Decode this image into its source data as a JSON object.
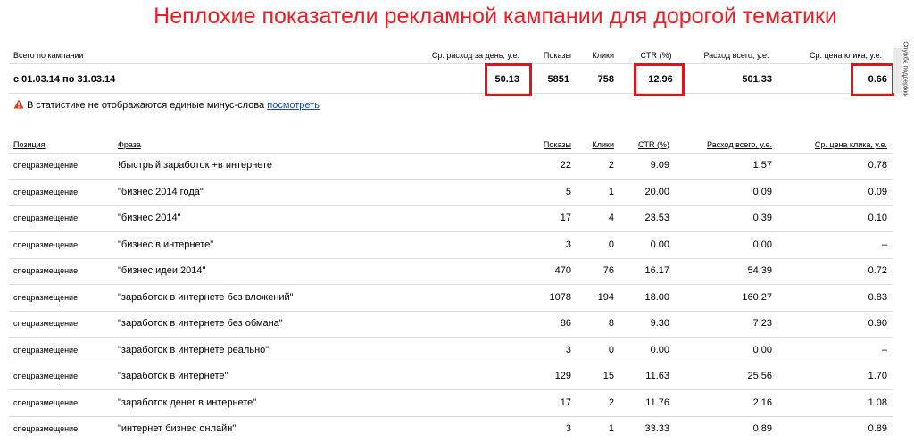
{
  "title": "Неплохие показатели рекламной кампании для дорогой тематики",
  "summary": {
    "headers": {
      "label": "Всего по кампании",
      "avg_daily": "Ср. расход за день, у.е.",
      "shows": "Показы",
      "clicks": "Клики",
      "ctr": "CTR (%)",
      "total": "Расход всего, у.е.",
      "cpc": "Ср. цена клика, у.е."
    },
    "period": "с 01.03.14 по 31.03.14",
    "avg_daily": "50.13",
    "shows": "5851",
    "clicks": "758",
    "ctr": "12.96",
    "total": "501.33",
    "cpc": "0.66"
  },
  "side_tab": "Служба поддержки",
  "notice": {
    "text": "В статистике не отображаются единые минус-слова",
    "link": "посмотреть"
  },
  "table": {
    "headers": {
      "position": "Позиция",
      "phrase": "Фраза",
      "shows": "Показы",
      "clicks": "Клики",
      "ctr": "CTR (%)",
      "total": "Расход всего, у.е.",
      "cpc": "Ср. цена клика, у.е."
    },
    "rows": [
      {
        "position": "спецразмещение",
        "phrase": "!быстрый заработок +в интернете",
        "shows": "22",
        "clicks": "2",
        "ctr": "9.09",
        "total": "1.57",
        "cpc": "0.78"
      },
      {
        "position": "спецразмещение",
        "phrase": "\"бизнес 2014 года\"",
        "shows": "5",
        "clicks": "1",
        "ctr": "20.00",
        "total": "0.09",
        "cpc": "0.09"
      },
      {
        "position": "спецразмещение",
        "phrase": "\"бизнес 2014\"",
        "shows": "17",
        "clicks": "4",
        "ctr": "23.53",
        "total": "0.39",
        "cpc": "0.10"
      },
      {
        "position": "спецразмещение",
        "phrase": "\"бизнес в интернете\"",
        "shows": "3",
        "clicks": "0",
        "ctr": "0.00",
        "total": "0.00",
        "cpc": "–"
      },
      {
        "position": "спецразмещение",
        "phrase": "\"бизнес идеи 2014\"",
        "shows": "470",
        "clicks": "76",
        "ctr": "16.17",
        "total": "54.39",
        "cpc": "0.72"
      },
      {
        "position": "спецразмещение",
        "phrase": "\"заработок в интернете без вложений\"",
        "shows": "1078",
        "clicks": "194",
        "ctr": "18.00",
        "total": "160.27",
        "cpc": "0.83"
      },
      {
        "position": "спецразмещение",
        "phrase": "\"заработок в интернете без обмана\"",
        "shows": "86",
        "clicks": "8",
        "ctr": "9.30",
        "total": "7.23",
        "cpc": "0.90"
      },
      {
        "position": "спецразмещение",
        "phrase": "\"заработок в интернете реально\"",
        "shows": "3",
        "clicks": "0",
        "ctr": "0.00",
        "total": "0.00",
        "cpc": "–"
      },
      {
        "position": "спецразмещение",
        "phrase": "\"заработок в интернете\"",
        "shows": "129",
        "clicks": "15",
        "ctr": "11.63",
        "total": "25.56",
        "cpc": "1.70"
      },
      {
        "position": "спецразмещение",
        "phrase": "\"заработок денег в интернете\"",
        "shows": "17",
        "clicks": "2",
        "ctr": "11.76",
        "total": "2.16",
        "cpc": "1.08"
      },
      {
        "position": "спецразмещение",
        "phrase": "\"интернет бизнес онлайн\"",
        "shows": "3",
        "clicks": "1",
        "ctr": "33.33",
        "total": "0.89",
        "cpc": "0.89"
      }
    ]
  },
  "colors": {
    "title": "#ee1c25",
    "highlight": "#e3111a",
    "link": "#1a4a9e",
    "divider": "#dcdcdc"
  }
}
